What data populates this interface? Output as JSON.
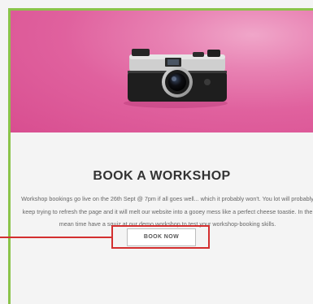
{
  "workshop": {
    "title": "BOOK A WORKSHOP",
    "description": "Workshop bookings go live on the 26th Sept @ 7pm if all goes well... which it probably won't. You lot will probably keep trying to refresh the page and it will melt our website into a gooey mess like a perfect cheese toastie. In the mean time have a squiz at our demo workshop to test your workshop-booking skills.",
    "button_label": "BOOK NOW"
  },
  "colors": {
    "frame_accent": "#8bc34a",
    "hero_pink": "#e0619e",
    "highlight_red": "#d32f2f"
  },
  "hero": {
    "image": "camera-illustration"
  }
}
